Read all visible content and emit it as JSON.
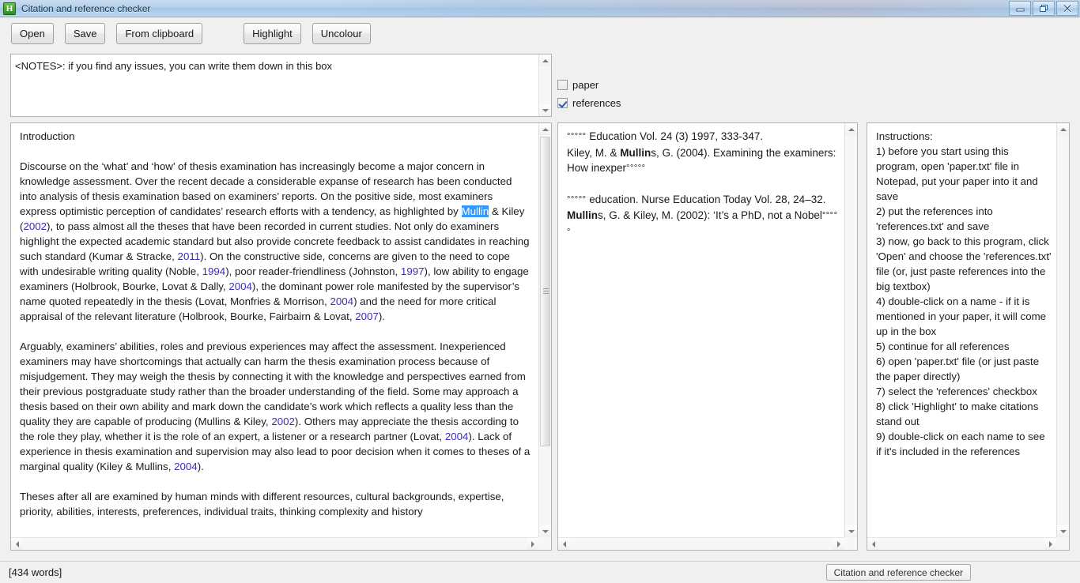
{
  "window": {
    "title": "Citation and reference checker",
    "icon": "app-icon-h",
    "icon_letter": "H",
    "controls": {
      "minimize": "minimize-icon",
      "restore": "restore-icon",
      "close": "close-icon"
    }
  },
  "toolbar": {
    "open_label": "Open",
    "save_label": "Save",
    "from_clipboard_label": "From clipboard",
    "highlight_label": "Highlight",
    "uncolour_label": "Uncolour"
  },
  "notes": {
    "value": "<NOTES>: if you find any issues, you can write them down in this box",
    "placeholder": "<NOTES>: if you find any issues, you can write them down in this box"
  },
  "checkboxes": [
    {
      "label": "paper",
      "checked": false
    },
    {
      "label": "references",
      "checked": true
    }
  ],
  "paper_panel": {
    "heading": "Introduction",
    "selected_word": "Mullin",
    "paragraphs": [
      {
        "id": "p1",
        "text": "Discourse on the ‘what’ and ‘how’ of thesis examination has increasingly become a major concern in knowledge assessment. Over the recent decade a considerable expanse of research has been conducted into analysis of thesis examination based on examiners’ reports. On the positive side, most examiners express optimistic perception of candidates’ research efforts with a tendency, as highlighted by Mullin & Kiley (2002), to pass almost all the theses that have been recorded in current studies. Not only do examiners highlight the expected academic standard but also provide concrete feedback to assist candidates in reaching such standard (Kumar & Stracke, 2011). On the constructive side, concerns are given to the need to cope with undesirable writing quality (Noble, 1994), poor reader-friendliness (Johnston, 1997), low ability to engage examiners (Holbrook, Bourke, Lovat & Dally, 2004), the dominant power role manifested by the supervisor’s name quoted repeatedly in the thesis (Lovat, Monfries & Morrison, 2004) and the need for more critical appraisal of the relevant literature (Holbrook, Bourke, Fairbairn & Lovat, 2007)."
      },
      {
        "id": "p2",
        "text": "Arguably, examiners’ abilities, roles and previous experiences may affect the assessment. Inexperienced examiners may have shortcomings that actually can harm the thesis examination process because of misjudgement. They may weigh the thesis by connecting it with the knowledge and perspectives earned from their previous postgraduate study rather than the broader understanding of the field. Some may approach a thesis based on their own ability and mark down the candidate’s work which reflects a quality less than the quality they are capable of producing (Mullins & Kiley, 2002). Others may appreciate the thesis according to the role they play, whether it is the role of an expert, a listener or a research partner (Lovat, 2004). Lack of experience in thesis examination and supervision may also lead to poor decision when it comes to theses of a marginal quality (Kiley & Mullins, 2004)."
      },
      {
        "id": "p3",
        "text": "Theses after all are examined by human minds with different resources, cultural backgrounds, expertise, priority, abilities, interests, preferences, individual traits, thinking complexity and history"
      }
    ],
    "citation_years": [
      "2002",
      "2011",
      "1994",
      "1997",
      "2004",
      "2004",
      "2007",
      "2002",
      "2004",
      "2004"
    ]
  },
  "references_panel": {
    "ellipsis": "°°°°°",
    "entries": [
      {
        "line1_tail": " Education Vol. 24 (3) 1997, 333-347.",
        "line2_pre": "Kiley, M. & ",
        "line2_bold": "Mullin",
        "line2_post": "s, G. (2004). Examining the examiners: How inexper"
      },
      {
        "line1_tail": " education. Nurse Education Today Vol. 28, 24–32.",
        "line2_pre": "",
        "line2_bold": "Mullin",
        "line2_post": "s, G. & Kiley, M. (2002): ‘It’s a PhD, not a Nobel"
      }
    ]
  },
  "instructions_panel": {
    "heading": "Instructions:",
    "steps": [
      "1) before you start using this program, open 'paper.txt' file in Notepad, put your paper into it and save",
      "2) put the references into 'references.txt' and save",
      "3) now, go back to this program, click 'Open' and choose the 'references.txt' file (or, just paste references into the big textbox)",
      "4) double-click on a name - if it is mentioned in your paper, it will come up in the box",
      "5) continue for all references",
      "6) open 'paper.txt' file (or just paste the paper directly)",
      "7) select the 'references' checkbox",
      "8) click 'Highlight' to make citations stand out",
      "9) double-click on each name to see if it's included in the references"
    ]
  },
  "statusbar": {
    "word_count": "[434 words]",
    "taskbar_button_label": "Citation and reference checker"
  },
  "colors": {
    "citation_year": "#3b2fb8",
    "selection_bg": "#3399ff",
    "selection_fg": "#ffffff",
    "app_chrome": "#f0f0f0",
    "title_gradient_top": "#c8dcf0"
  }
}
